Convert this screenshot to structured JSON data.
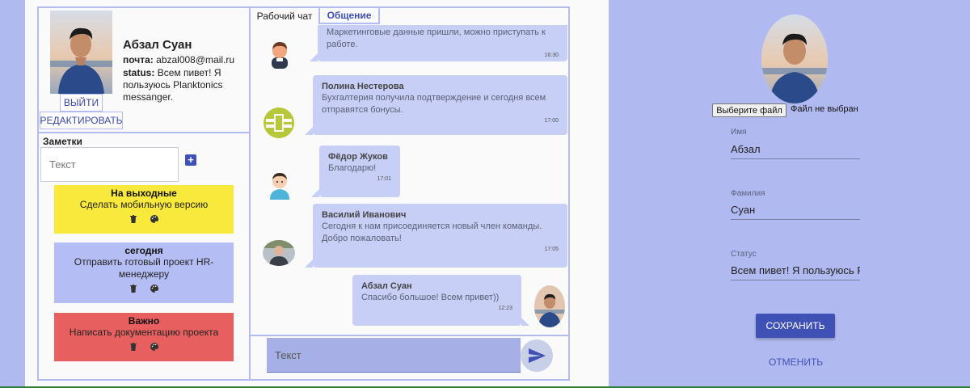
{
  "profile": {
    "name": "Абзал Суан",
    "email_label": "почта:",
    "email": "abzal008@mail.ru",
    "status_label": "status:",
    "status": "Всем пивет! Я пользуюсь Planktonics messanger.",
    "logout_label": "ВЫЙТИ",
    "edit_label": "РЕДАКТИРОВАТЬ"
  },
  "notes": {
    "title": "Заметки",
    "input_placeholder": "Текст",
    "items": [
      {
        "title": "На выходные",
        "text": "Сделать мобильную версию",
        "color": "#f9e93c"
      },
      {
        "title": "сегодня",
        "text": "Отправить готовый проект HR-менеджеру",
        "color": "#b5bef4"
      },
      {
        "title": "Важно",
        "text": "Написать документацию проекта",
        "color": "#e85f5f"
      }
    ]
  },
  "chat": {
    "tabs": [
      {
        "label": "Рабочий чат",
        "active": false
      },
      {
        "label": "Общение",
        "active": true
      }
    ],
    "messages": [
      {
        "author": "",
        "text": "Маркетинговые данные пришли, можно приступать к работе.",
        "time": "16:30",
        "avatar": "man-avatar"
      },
      {
        "author": "Полина Нестерова",
        "text": "Бухгалтерия получила подтверждение и сегодня всем отправятся бонусы.",
        "time": "17:00",
        "avatar": "green-logo-avatar"
      },
      {
        "author": "Фёдор Жуков",
        "text": "Благодарю!",
        "time": "17:01",
        "avatar": "man-avatar"
      },
      {
        "author": "Василий Иванович",
        "text": "Сегодня к нам присоединяется новый член команды. Добро пожаловать!",
        "time": "17:05",
        "avatar": "photo-avatar"
      },
      {
        "author": "Абзал Суан",
        "text": "Спасибо большое! Всем привет))",
        "time": "12:23",
        "avatar": "user-photo-avatar",
        "own": true
      }
    ],
    "input_placeholder": "Текст"
  },
  "edit_panel": {
    "file_button_label": "Выберите файл",
    "file_status": "Файл не выбран",
    "first_name_label": "Имя",
    "first_name": "Абзал",
    "last_name_label": "Фамилия",
    "last_name": "Суан",
    "status_label": "Статус",
    "status": "Всем пивет! Я пользуюсь Planktonics messanger.",
    "save_label": "СОХРАНИТЬ",
    "cancel_label": "ОТМЕНИТЬ"
  },
  "colors": {
    "page_bg": "#b0baf0",
    "accent": "#3f51b5",
    "frame": "#b3bcf2",
    "bubble": "#c7cff7"
  }
}
